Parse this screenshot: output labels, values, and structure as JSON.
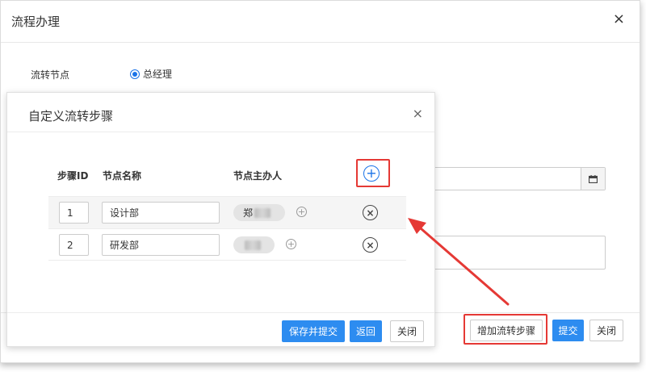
{
  "outer_dialog": {
    "title": "流程办理",
    "close_glyph": "×",
    "node_label": "流转节点",
    "node_option": "总经理",
    "calendar_icon": "calendar-icon",
    "buttons": {
      "add_step": "增加流转步骤",
      "submit": "提交",
      "close": "关闭"
    }
  },
  "inner_dialog": {
    "title": "自定义流转步骤",
    "close_glyph": "×",
    "columns": {
      "step_id": "步骤ID",
      "node_name": "节点名称",
      "node_owner": "节点主办人"
    },
    "add_row_glyph": "+",
    "rows": [
      {
        "step_id": "1",
        "node_name": "设计部",
        "owner_visible": "郑"
      },
      {
        "step_id": "2",
        "node_name": "研发部",
        "owner_visible": ""
      }
    ],
    "add_owner_glyph": "+",
    "remove_glyph": "×",
    "buttons": {
      "save_submit": "保存并提交",
      "back": "返回",
      "close": "关闭"
    }
  },
  "colors": {
    "primary": "#2d8cf0",
    "highlight": "#e53935",
    "radio": "#1a73e8"
  }
}
